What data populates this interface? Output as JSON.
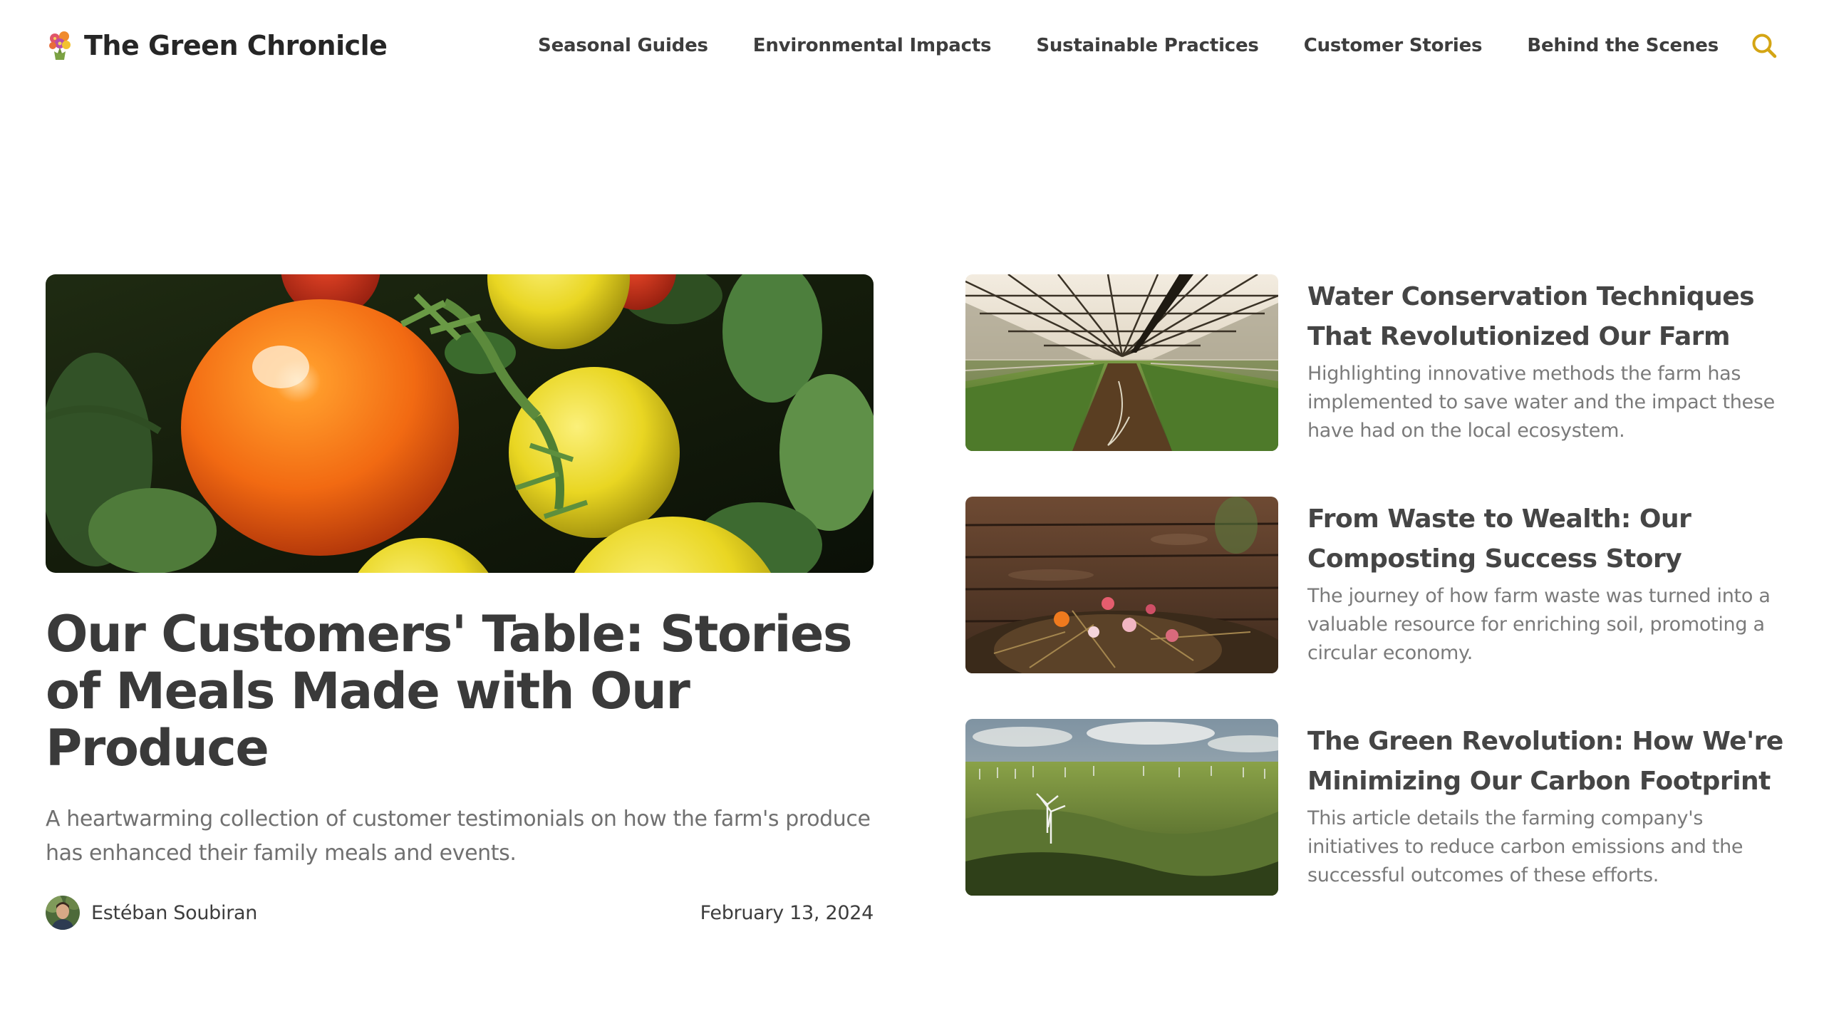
{
  "site": {
    "title": "The Green Chronicle",
    "logo_icon": "flower-bouquet-icon"
  },
  "nav": {
    "items": [
      {
        "label": "Seasonal Guides"
      },
      {
        "label": "Environmental Impacts"
      },
      {
        "label": "Sustainable Practices"
      },
      {
        "label": "Customer Stories"
      },
      {
        "label": "Behind the Scenes"
      }
    ],
    "search_icon": "search-icon"
  },
  "featured": {
    "image_icon": "tomatoes-photo",
    "title": "Our Customers' Table: Stories of Meals Made with Our Produce",
    "excerpt": "A heartwarming collection of customer testimonials on how the farm's produce has enhanced their family meals and events.",
    "author": "Estéban Soubiran",
    "date": "February 13, 2024"
  },
  "articles": [
    {
      "image_icon": "greenhouse-photo",
      "title": "Water Conservation Techniques That Revolutionized Our Farm",
      "excerpt": "Highlighting innovative methods the farm has implemented to save water and the impact these have had on the local ecosystem."
    },
    {
      "image_icon": "compost-photo",
      "title": "From Waste to Wealth: Our Composting Success Story",
      "excerpt": "The journey of how farm waste was turned into a valuable resource for enriching soil, promoting a circular economy."
    },
    {
      "image_icon": "wind-turbines-photo",
      "title": "The Green Revolution: How We're Minimizing Our Carbon Footprint",
      "excerpt": "This article details the farming company's initiatives to reduce carbon emissions and the successful outcomes of these efforts."
    }
  ],
  "colors": {
    "accent": "#d4a514",
    "heading": "#3a3a3a",
    "muted": "#707070"
  }
}
